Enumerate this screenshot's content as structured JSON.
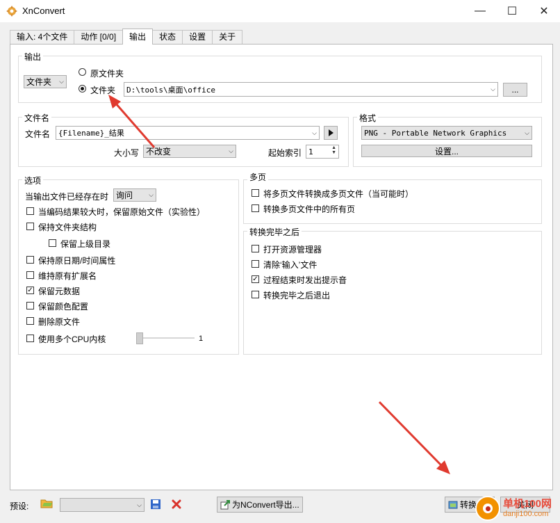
{
  "window": {
    "title": "XnConvert",
    "minimize": "—",
    "maximize": "☐",
    "close": "✕"
  },
  "tabs": [
    "输入: 4个文件",
    "动作 [0/0]",
    "输出",
    "状态",
    "设置",
    "关于"
  ],
  "active_tab": 2,
  "output_group": {
    "title": "输出",
    "folder_type": "文件夹",
    "radio_original": "原文件夹",
    "radio_folder": "文件夹",
    "selected_radio": "folder",
    "path": "D:\\tools\\桌面\\office",
    "browse": "..."
  },
  "filename_group": {
    "title": "文件名",
    "label": "文件名",
    "pattern": "{Filename}_结果",
    "case_label": "大小写",
    "case_value": "不改变",
    "start_index_label": "起始索引",
    "start_index_value": "1"
  },
  "format_group": {
    "title": "格式",
    "format_value": "PNG - Portable Network Graphics",
    "settings_button": "设置..."
  },
  "options_group": {
    "title": "选项",
    "exists_label": "当输出文件已经存在时",
    "exists_value": "询问",
    "items": [
      {
        "label": "当编码结果较大时，保留原始文件（实验性）",
        "checked": false
      },
      {
        "label": "保持文件夹结构",
        "checked": false
      },
      {
        "label": "保留上级目录",
        "checked": false
      },
      {
        "label": "保持原日期/时间属性",
        "checked": false
      },
      {
        "label": "维持原有扩展名",
        "checked": false
      },
      {
        "label": "保留元数据",
        "checked": true
      },
      {
        "label": "保留颜色配置",
        "checked": false
      },
      {
        "label": "删除原文件",
        "checked": false
      },
      {
        "label": "使用多个CPU内核",
        "checked": false
      }
    ],
    "cpu_value": "1"
  },
  "multipage_group": {
    "title": "多页",
    "items": [
      {
        "label": "将多页文件转换成多页文件（当可能时）",
        "checked": false
      },
      {
        "label": "转换多页文件中的所有页",
        "checked": false
      }
    ]
  },
  "after_group": {
    "title": "转换完毕之后",
    "items": [
      {
        "label": "打开资源管理器",
        "checked": false
      },
      {
        "label": "清除‘输入’文件",
        "checked": false
      },
      {
        "label": "过程结束时发出提示音",
        "checked": true
      },
      {
        "label": "转换完毕之后退出",
        "checked": false
      }
    ]
  },
  "footer": {
    "preset_label": "预设:",
    "export_button": "为NConvert导出...",
    "convert_button": "转换",
    "close_button": "关闭"
  },
  "watermark": {
    "line1": "单机100网",
    "line2": "danji100.com"
  },
  "colors": {
    "arrow": "#e03a2f",
    "accent_icon": "#f2b63c",
    "delete_icon": "#d9322b",
    "save_icon": "#2f66c9"
  }
}
